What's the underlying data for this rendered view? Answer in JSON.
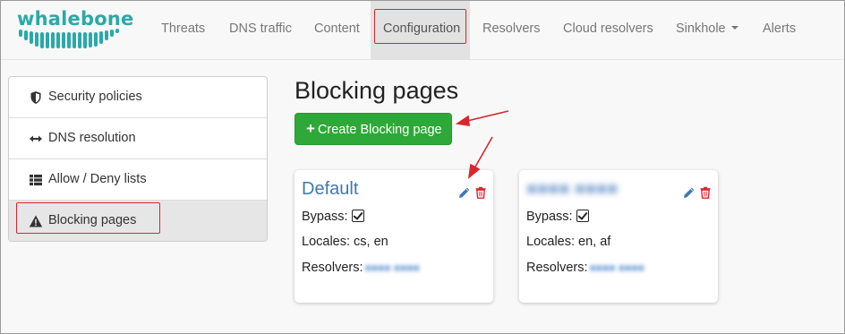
{
  "brand": {
    "name": "whalebone",
    "color": "#2aa9a8"
  },
  "nav": {
    "items": [
      {
        "label": "Threats"
      },
      {
        "label": "DNS traffic"
      },
      {
        "label": "Content"
      },
      {
        "label": "Configuration",
        "active": true
      },
      {
        "label": "Resolvers"
      },
      {
        "label": "Cloud resolvers"
      },
      {
        "label": "Sinkhole",
        "dropdown": true
      },
      {
        "label": "Alerts"
      }
    ]
  },
  "sidebar": {
    "items": [
      {
        "label": "Security policies",
        "icon": "shield-icon"
      },
      {
        "label": "DNS resolution",
        "icon": "arrows-horizontal-icon"
      },
      {
        "label": "Allow / Deny lists",
        "icon": "list-icon"
      },
      {
        "label": "Blocking pages",
        "icon": "warning-icon",
        "active": true
      }
    ]
  },
  "main": {
    "title": "Blocking pages",
    "create_button": "Create Blocking page",
    "create_button_color": "#2ea838"
  },
  "cards": [
    {
      "title": "Default",
      "bypass_label": "Bypass:",
      "bypass_checked": true,
      "locales_label": "Locales:",
      "locales": "cs, en",
      "resolvers_label": "Resolvers:"
    },
    {
      "title_blurred": true,
      "bypass_label": "Bypass:",
      "bypass_checked": true,
      "locales_label": "Locales:",
      "locales": "en, af",
      "resolvers_label": "Resolvers:"
    }
  ],
  "annotation_color": "#d9262e"
}
